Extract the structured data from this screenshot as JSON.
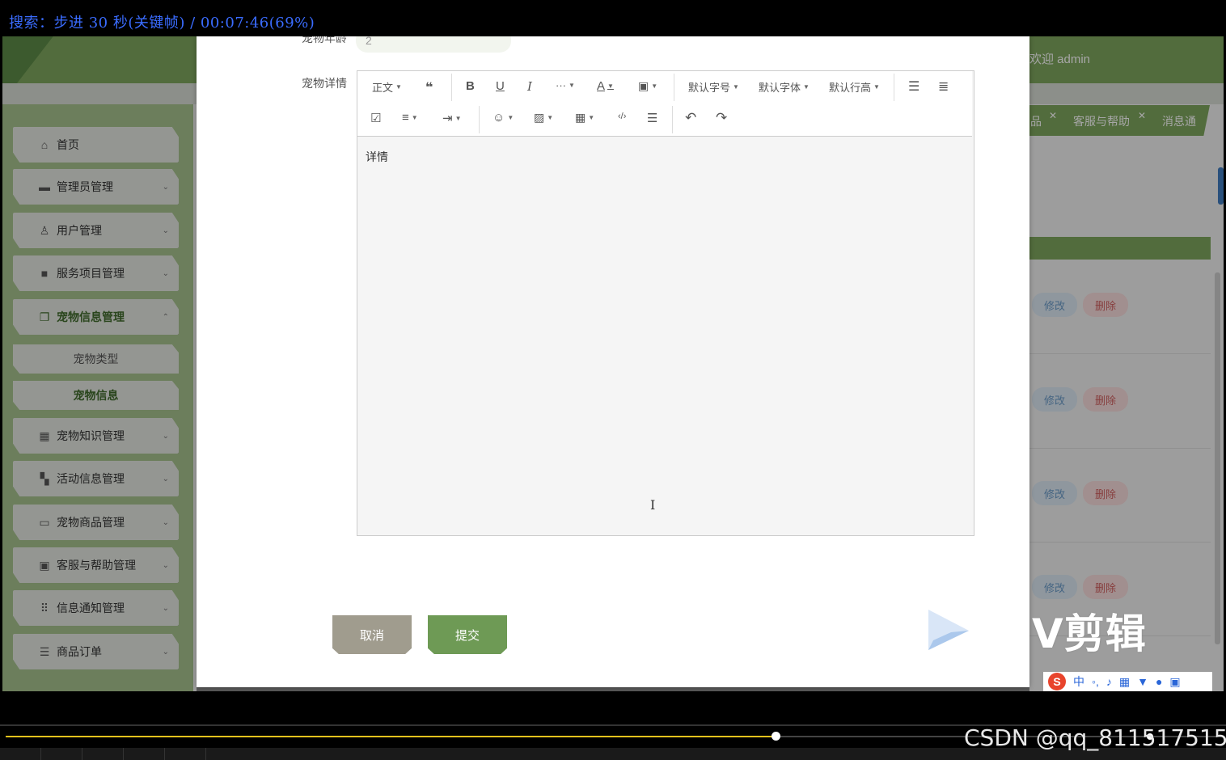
{
  "osd": {
    "text": "搜索：步进 30 秒(关键帧) / 00:07:46(69%)"
  },
  "header": {
    "welcome": "欢迎 admin"
  },
  "sidebar": {
    "items": [
      {
        "label": "首页",
        "icon": "home-icon"
      },
      {
        "label": "管理员管理",
        "icon": "card-icon"
      },
      {
        "label": "用户管理",
        "icon": "user-icon"
      },
      {
        "label": "服务项目管理",
        "icon": "book-icon"
      },
      {
        "label": "宠物信息管理",
        "icon": "copy-icon"
      },
      {
        "label": "宠物知识管理",
        "icon": "grid-icon"
      },
      {
        "label": "活动信息管理",
        "icon": "tiles-icon"
      },
      {
        "label": "宠物商品管理",
        "icon": "box-icon"
      },
      {
        "label": "客服与帮助管理",
        "icon": "image-icon"
      },
      {
        "label": "信息通知管理",
        "icon": "apps-icon"
      },
      {
        "label": "商品订单",
        "icon": "archive-icon"
      }
    ],
    "sub_items": [
      {
        "label": "宠物类型"
      },
      {
        "label": "宠物信息"
      }
    ]
  },
  "tabs": [
    {
      "label": "品"
    },
    {
      "label": "客服与帮助"
    },
    {
      "label": "消息通"
    }
  ],
  "table": {
    "edit_label": "修改",
    "delete_label": "删除"
  },
  "form": {
    "age_label": "宠物年龄",
    "age_value": "2",
    "detail_label": "宠物详情",
    "editor_content": "详情",
    "toolbar": {
      "paragraph": "正文",
      "font_size": "默认字号",
      "font_family": "默认字体",
      "line_height": "默认行高"
    },
    "cancel_label": "取消",
    "submit_label": "提交"
  },
  "watermark": {
    "text": "V剪辑"
  },
  "ime": {
    "lang": "中"
  },
  "player": {
    "progress_percent": 69,
    "credit": "CSDN @qq_811517515"
  },
  "colors": {
    "theme_green": "#7fa65e",
    "accent_yellow": "#e2c11c",
    "osd_blue": "#3a6cff"
  }
}
